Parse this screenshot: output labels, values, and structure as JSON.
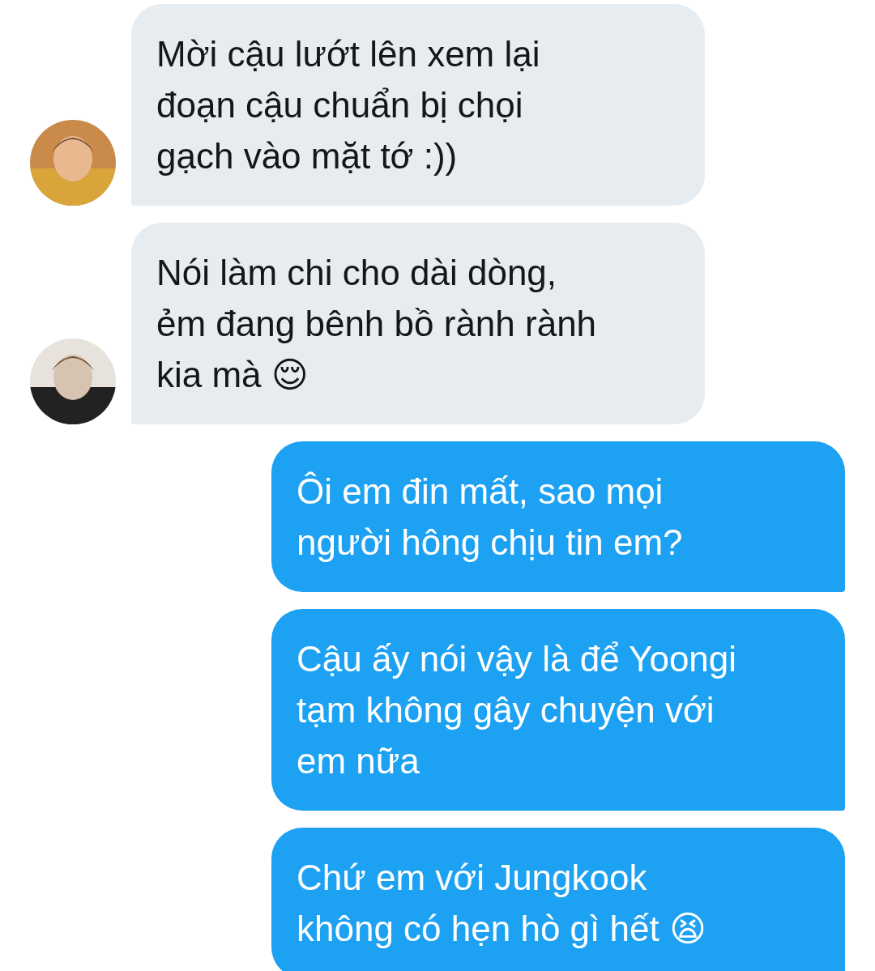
{
  "messages": [
    {
      "kind": "received",
      "text": "Mời cậu lướt lên xem lại\nđoạn cậu chuẩn bị chọi\ngạch vào mặt tớ :))"
    },
    {
      "kind": "received",
      "text": "Nói làm chi cho dài dòng,\nẻm đang bênh bồ rành rành\nkia mà 😌"
    },
    {
      "kind": "sent",
      "text": "Ôi em đin mất, sao mọi\nngười hông chịu tin em?"
    },
    {
      "kind": "sent",
      "text": "Cậu ấy nói vậy là để Yoongi\ntạm không gây chuyện với\nem nữa"
    },
    {
      "kind": "sent",
      "text": "Chứ em với Jungkook\nkhông có hẹn hò gì hết 😫"
    }
  ]
}
